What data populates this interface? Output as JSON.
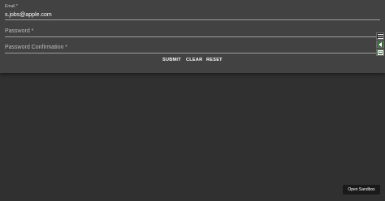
{
  "form": {
    "email": {
      "label": "Email *",
      "value": "s.jobs@apple.com"
    },
    "password": {
      "label": "Password *"
    },
    "password_confirmation": {
      "label": "Password Confirmation *"
    }
  },
  "actions": {
    "submit": "SUBMIT",
    "clear": "CLEAR",
    "reset": "RESET"
  },
  "side_tools": {
    "icons": [
      "menu-icon",
      "arrow-left-icon",
      "panel-icon"
    ]
  },
  "sandbox": {
    "label": "Open Sandbox"
  },
  "colors": {
    "background": "#303030",
    "card": "#424242",
    "accent_green": "#3f6b3f"
  }
}
